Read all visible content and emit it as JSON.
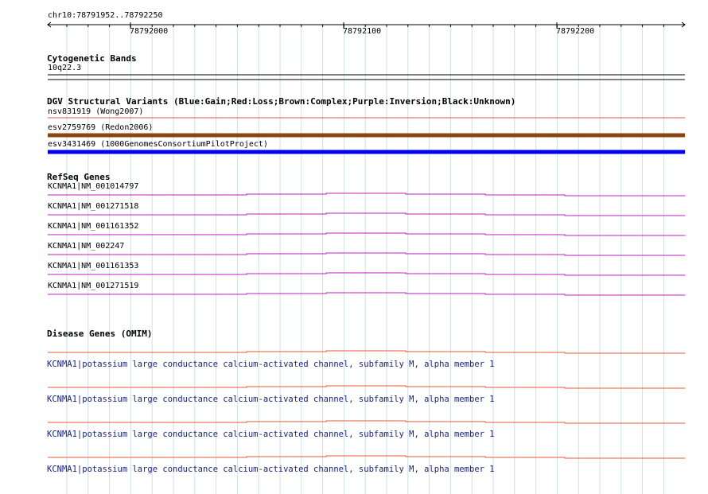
{
  "location": "chr10:78791952..78792250",
  "ruler": {
    "ticks": [
      "78792000",
      "78792100",
      "78792200"
    ]
  },
  "colors": {
    "grid": "#cde0ea",
    "ruler": "#000000",
    "refseq": "#c020c0",
    "omim_line": "#e55a3a",
    "omim_text": "#1a237e",
    "loss": "#e05050",
    "complex": "#8b4513",
    "gain": "#0000ee"
  },
  "cytoband": {
    "title": "Cytogenetic Bands",
    "band": "10q22.3"
  },
  "dgv": {
    "title": "DGV Structural Variants (Blue:Gain;Red:Loss;Brown:Complex;Purple:Inversion;Black:Unknown)",
    "items": [
      {
        "label": "nsv831919 (Wong2007)",
        "type": "loss"
      },
      {
        "label": "esv2759769 (Redon2006)",
        "type": "complex"
      },
      {
        "label": "esv3431469 (1000GenomesConsortiumPilotProject)",
        "type": "gain"
      }
    ]
  },
  "refseq": {
    "title": "RefSeq Genes",
    "items": [
      "KCNMA1|NM_001014797",
      "KCNMA1|NM_001271518",
      "KCNMA1|NM_001161352",
      "KCNMA1|NM_002247",
      "KCNMA1|NM_001161353",
      "KCNMA1|NM_001271519"
    ]
  },
  "omim": {
    "title": "Disease Genes (OMIM)",
    "items": [
      "KCNMA1|potassium large conductance calcium-activated channel, subfamily M, alpha member 1",
      "KCNMA1|potassium large conductance calcium-activated channel, subfamily M, alpha member 1",
      "KCNMA1|potassium large conductance calcium-activated channel, subfamily M, alpha member 1",
      "KCNMA1|potassium large conductance calcium-activated channel, subfamily M, alpha member 1"
    ]
  }
}
